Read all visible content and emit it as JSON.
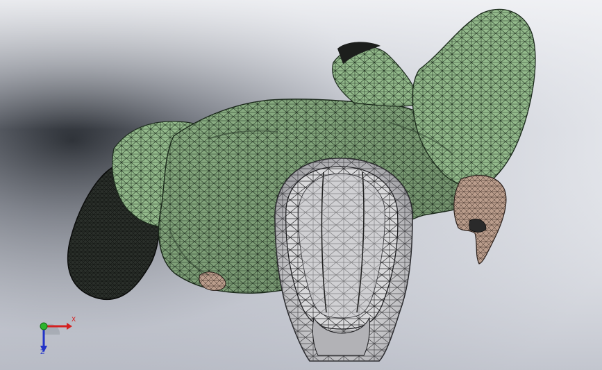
{
  "viewport": {
    "background_top": "#eceef3",
    "background_bottom": "#a7abb8",
    "model_colors": {
      "body": "#8fb487",
      "body_dark": "#4f6b4c",
      "mesh_edge": "#1b2a1b",
      "skin": "#b89a88",
      "helmet": "#d4d4d6",
      "helmet_dark": "#8a8a8e",
      "shadow": "#1a1a1c"
    }
  },
  "triad": {
    "x_label": "X",
    "z_label": "Z",
    "x_color": "#d42020",
    "y_color": "#2db52d",
    "z_color": "#2233c8",
    "icon": "coordinate-triad-icon"
  }
}
